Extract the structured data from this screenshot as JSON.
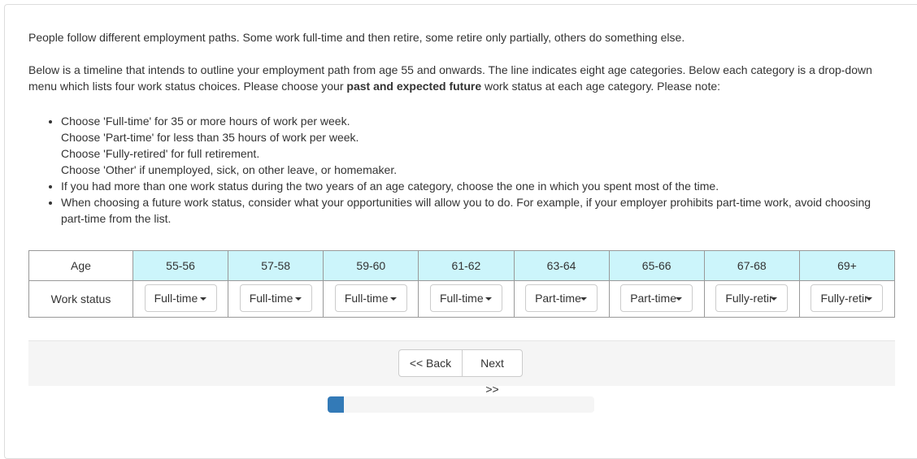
{
  "intro": "People follow different employment paths. Some work full-time and then retire, some retire only partially, others do something else.",
  "para2": {
    "before": "Below is a timeline that intends to outline your employment path from age 55 and onwards. The line indicates eight age categories. Below each category is a drop-down menu which lists four work status choices. Please choose your ",
    "bold": "past and expected future",
    "after": " work status at each age category. Please note:"
  },
  "bullets": {
    "first": [
      "Choose 'Full-time' for 35 or more hours of work per week.",
      "Choose 'Part-time' for less than 35 hours of work per week.",
      "Choose 'Fully-retired' for full retirement.",
      "Choose 'Other' if unemployed, sick, on other leave, or homemaker."
    ],
    "second": "If you had more than one work status during the two years of an age category, choose the one in which you spent most of the time.",
    "third": "When choosing a future work status, consider what your opportunities will allow you to do. For example, if your employer prohibits part-time work, avoid choosing part-time from the list."
  },
  "table": {
    "age_header": "Age",
    "status_header": "Work status",
    "ages": [
      "55-56",
      "57-58",
      "59-60",
      "61-62",
      "63-64",
      "65-66",
      "67-68",
      "69+"
    ],
    "statuses": [
      "Full-time",
      "Full-time",
      "Full-time",
      "Full-time",
      "Part-time",
      "Part-time",
      "Fully-retired",
      "Fully-retired"
    ],
    "header_color": "#ccf5fb"
  },
  "nav": {
    "back_label": "<< Back",
    "next_label": "Next >>"
  },
  "progress": {
    "percent": 6,
    "color": "#337ab7"
  }
}
